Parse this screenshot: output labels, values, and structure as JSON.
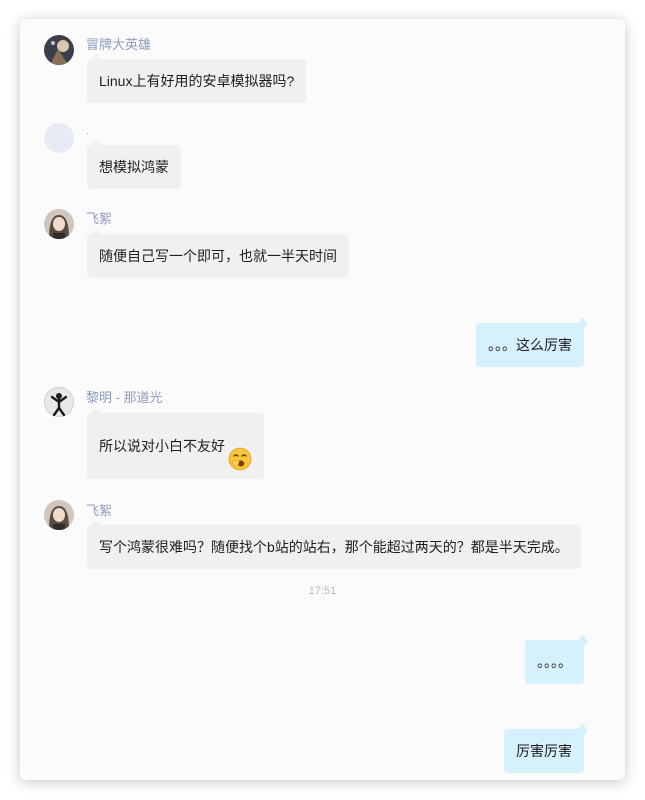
{
  "messages": [
    {
      "sender": "冒牌大英雄",
      "text": "Linux上有好用的安卓模拟器吗?"
    },
    {
      "sender": "·",
      "text": "想模拟鸿蒙"
    },
    {
      "sender": "飞絮",
      "text": "随便自己写一个即可，也就一半天时间"
    },
    {
      "text": "。。。这么厉害"
    },
    {
      "sender": "黎明 - 那道光",
      "text": "所以说对小白不友好",
      "emoji": "yawning-face-icon"
    },
    {
      "sender": "飞絮",
      "text": "写个鸿蒙很难吗？随便找个b站的站右，那个能超过两天的？都是半天完成。"
    },
    {
      "text": "。。。。"
    },
    {
      "text": "厉害厉害"
    }
  ],
  "timestamp": "17:51",
  "colors": {
    "incoming_bubble": "#f0f0f0",
    "outgoing_bubble": "#d6f0fc",
    "sender_name": "#8e9bbe",
    "timestamp": "#b8b8b8"
  }
}
